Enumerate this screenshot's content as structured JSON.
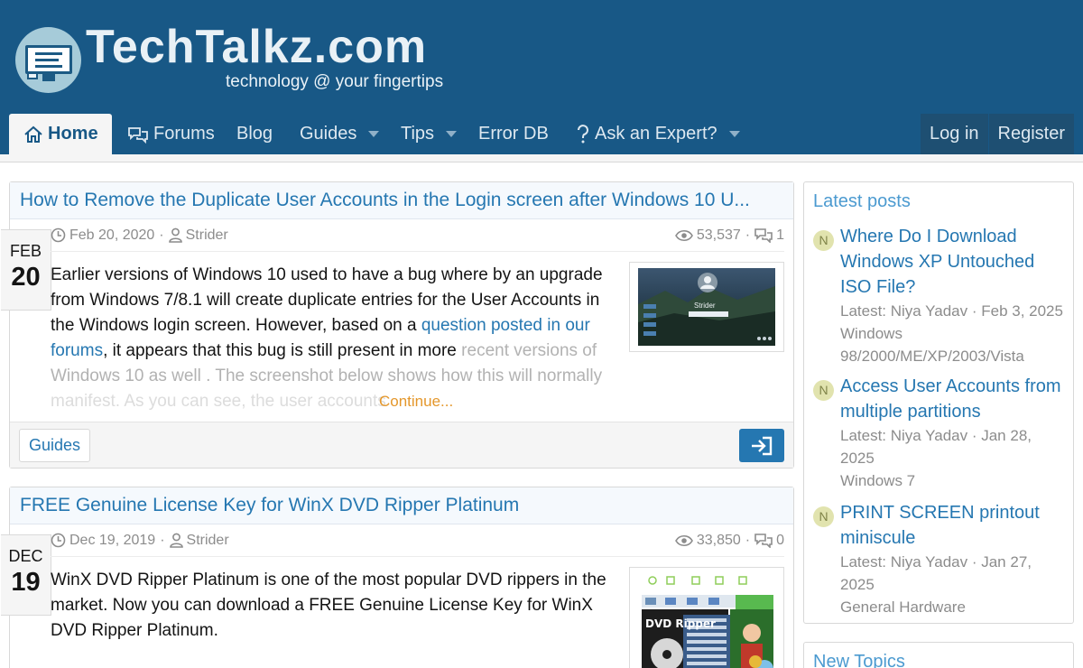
{
  "site": {
    "name": "TechTalkz.com",
    "tagline": "technology @ your fingertips"
  },
  "nav": {
    "items": [
      {
        "label": "Home",
        "icon": "home-icon",
        "active": true
      },
      {
        "label": "Forums",
        "icon": "comments-icon"
      },
      {
        "label": "Blog"
      },
      {
        "label": "Guides",
        "dropdown": true
      },
      {
        "label": "Tips",
        "dropdown": true
      },
      {
        "label": "Error DB"
      },
      {
        "label": "Ask an Expert?",
        "icon": "question-icon",
        "dropdown": true
      }
    ],
    "login": "Log in",
    "register": "Register"
  },
  "articles": [
    {
      "title": "How to Remove the Duplicate User Accounts in the Login screen after Windows 10 U...",
      "month": "FEB",
      "day": "20",
      "date": "Feb 20, 2020",
      "author": "Strider",
      "views": "53,537",
      "replies": "1",
      "text_1": "Earlier versions of Windows 10 used to have a bug where by an upgrade from Windows 7/8.1 will create duplicate entries for the User Accounts in the Windows login screen. However, based on a ",
      "link": "question posted in our forums",
      "text_2": ", it appears that this bug is still present in more",
      "text_fade": "recent versions of Windows 10 as well . The screenshot below shows how this will normally",
      "text_fade2": "manifest. As you can see, the user accounts",
      "continue": "Continue...",
      "tag": "Guides",
      "thumb_user": "Strider"
    },
    {
      "title": "FREE Genuine License Key for WinX DVD Ripper Platinum",
      "month": "DEC",
      "day": "19",
      "date": "Dec 19, 2019",
      "author": "Strider",
      "views": "33,850",
      "replies": "0",
      "text_1": "WinX DVD Ripper Platinum is one of the most popular DVD rippers in the market. Now you can download a FREE Genuine License Key for WinX DVD Ripper Platinum.",
      "thumb_label": "DVD Ripper"
    }
  ],
  "sidebar": {
    "latest_title": "Latest posts",
    "posts": [
      {
        "avatar": "N",
        "title": "Where Do I Download Windows XP Untouched ISO File?",
        "meta": "Latest: Niya Yadav · Feb 3, 2025",
        "forum": "Windows 98/2000/ME/XP/2003/Vista"
      },
      {
        "avatar": "N",
        "title": "Access User Accounts from multiple partitions",
        "meta": "Latest: Niya Yadav · Jan 28, 2025",
        "forum": "Windows 7"
      },
      {
        "avatar": "N",
        "title": "PRINT SCREEN printout miniscule",
        "meta": "Latest: Niya Yadav · Jan 27, 2025",
        "forum": "General Hardware"
      }
    ],
    "new_topics_title": "New Topics"
  },
  "colors": {
    "header": "#185886",
    "link": "#2577b1",
    "accent": "#e4972b"
  }
}
